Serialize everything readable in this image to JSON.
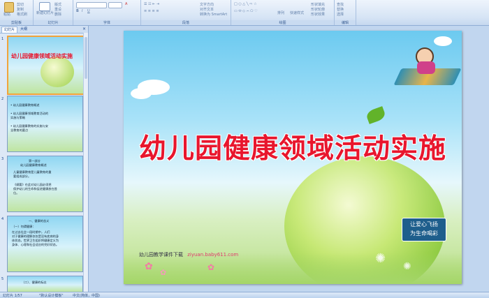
{
  "ribbon": {
    "groups": [
      {
        "label": "剪贴板",
        "buttons": [
          "粘贴",
          "剪切",
          "复制",
          "格式刷"
        ]
      },
      {
        "label": "幻灯片",
        "buttons": [
          "新建幻灯片",
          "版式",
          "重设",
          "删除"
        ]
      },
      {
        "label": "字体",
        "buttons": []
      },
      {
        "label": "段落",
        "buttons": [
          "文字方向",
          "对齐文本",
          "转换为 SmartArt"
        ]
      },
      {
        "label": "绘图",
        "buttons": [
          "排列",
          "快速样式",
          "形状填充",
          "形状轮廓",
          "形状效果"
        ]
      },
      {
        "label": "编辑",
        "buttons": [
          "查找",
          "替换",
          "选择"
        ]
      }
    ]
  },
  "panel": {
    "tabs": [
      "幻灯片",
      "大纲"
    ],
    "thumbnails": [
      {
        "num": "1",
        "lines": [
          "幼儿园健康领域活动实施"
        ]
      },
      {
        "num": "2",
        "lines": [
          "• 幼儿园健康教育概述",
          "• 幼儿园健康领域教育活动的",
          "  实施与策略",
          "• 幼儿园健康教育的实施与安",
          "  全教育的要点"
        ]
      },
      {
        "num": "3",
        "lines": [
          "第一部分",
          "幼儿园健康教育概述",
          "儿童健康教育是儿童教育的重",
          "要组成部分。",
          "《纲要》在此对幼儿园必须把",
          "保护幼儿的生命和促进健康放在首",
          "位。"
        ]
      },
      {
        "num": "4",
        "lines": [
          "一、健康的含义",
          "（一）何谓健康：",
          "在过去社会一段时期中，人们",
          "对于健康的理解仅仅是没有疾病的身",
          "体状态。世界卫生组织将健康定义为",
          "身体、心理和社会适应的完好状态。"
        ]
      },
      {
        "num": "5",
        "lines": [
          "（二）、健康的标志"
        ]
      }
    ]
  },
  "slide": {
    "title": "幼儿园健康领域活动实施",
    "footer_text": "幼儿园教学课件下载",
    "footer_url": "ziyuan.baby611.com",
    "badge_line1": "让爱心飞扬",
    "badge_line2": "为生命喝彩"
  },
  "status": {
    "slide_info": "幻灯片 1/57",
    "theme": "\"默认设计模板\"",
    "language": "中文(简体，中国)"
  },
  "colors": {
    "title": "#e8162d",
    "accent": "#f2a33a"
  }
}
